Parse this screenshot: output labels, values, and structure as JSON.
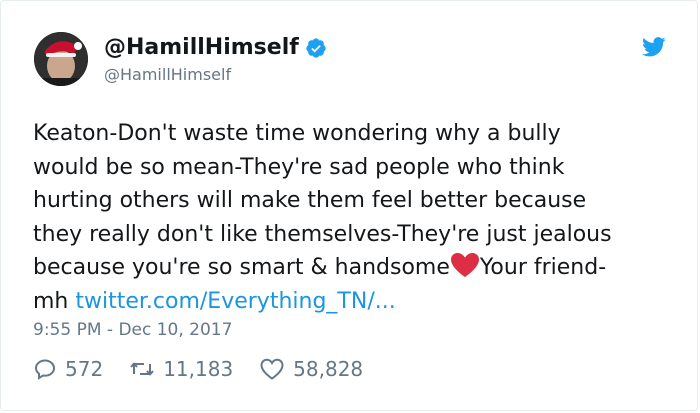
{
  "user": {
    "display_name": "@HamillHimself",
    "screen_name": "@HamillHimself"
  },
  "icons": {
    "avatar": "avatar",
    "verified": "verified-badge-icon",
    "bird": "twitter-bird-icon",
    "heart_emoji": "red-heart-icon",
    "reply": "reply-icon",
    "retweet": "retweet-icon",
    "like": "heart-outline-icon"
  },
  "colors": {
    "link": "#1b95e0",
    "muted": "#657786",
    "heart": "#e0245e"
  },
  "tweet": {
    "text_before_heart": "Keaton-Don't waste time wondering why a bully\nwould be so mean-They're sad people who think\nhurting others will make them feel better because\nthey really don't like themselves-They're just jealous\nbecause you're so smart & handsome",
    "text_after_heart": "Your friend-\nmh ",
    "link": "twitter.com/Everything_TN/...",
    "timestamp": "9:55 PM - Dec 10, 2017"
  },
  "stats": {
    "replies": "572",
    "retweets": "11,183",
    "likes": "58,828"
  }
}
